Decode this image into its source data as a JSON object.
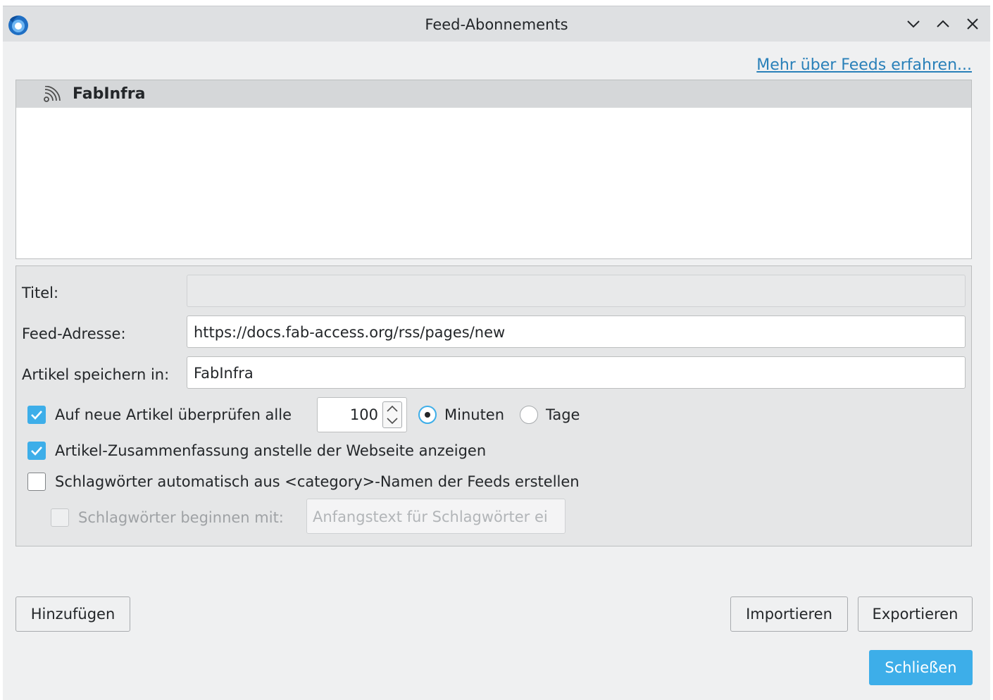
{
  "window": {
    "title": "Feed-Abonnements",
    "icons": [
      "thunderbird-app-icon",
      "minimize-icon",
      "maximize-icon",
      "close-icon"
    ]
  },
  "learn_more_link": "Mehr über Feeds erfahren...",
  "feed_tree": {
    "items": [
      {
        "label": "FabInfra",
        "icon": "rss-icon",
        "selected": true
      }
    ]
  },
  "properties": {
    "title_label": "Titel:",
    "title_value": "",
    "feed_address_label": "Feed-Adresse:",
    "feed_address_value": "https://docs.fab-access.org/rss/pages/new",
    "store_in_label": "Artikel speichern in:",
    "store_in_value": "FabInfra",
    "check_new": {
      "label": "Auf neue Artikel überprüfen alle",
      "checked": true,
      "interval": "100",
      "unit_minutes": "Minuten",
      "unit_days": "Tage",
      "selected_unit": "Minuten"
    },
    "show_summary": {
      "label": "Artikel-Zusammenfassung anstelle der Webseite anzeigen",
      "checked": true
    },
    "auto_tags": {
      "label": "Schlagwörter automatisch aus <category>-Namen der Feeds erstellen",
      "checked": false
    },
    "tag_prefix": {
      "label": "Schlagwörter beginnen mit:",
      "checked": false,
      "disabled": true,
      "placeholder": "Anfangstext für Schlagwörter ei"
    }
  },
  "buttons": {
    "add": "Hinzufügen",
    "import": "Importieren",
    "export": "Exportieren",
    "close": "Schließen"
  },
  "colors": {
    "accent": "#3daee9",
    "link": "#2980b9",
    "window_bg": "#eff0f1",
    "selection_bg": "#d5d7d9"
  }
}
